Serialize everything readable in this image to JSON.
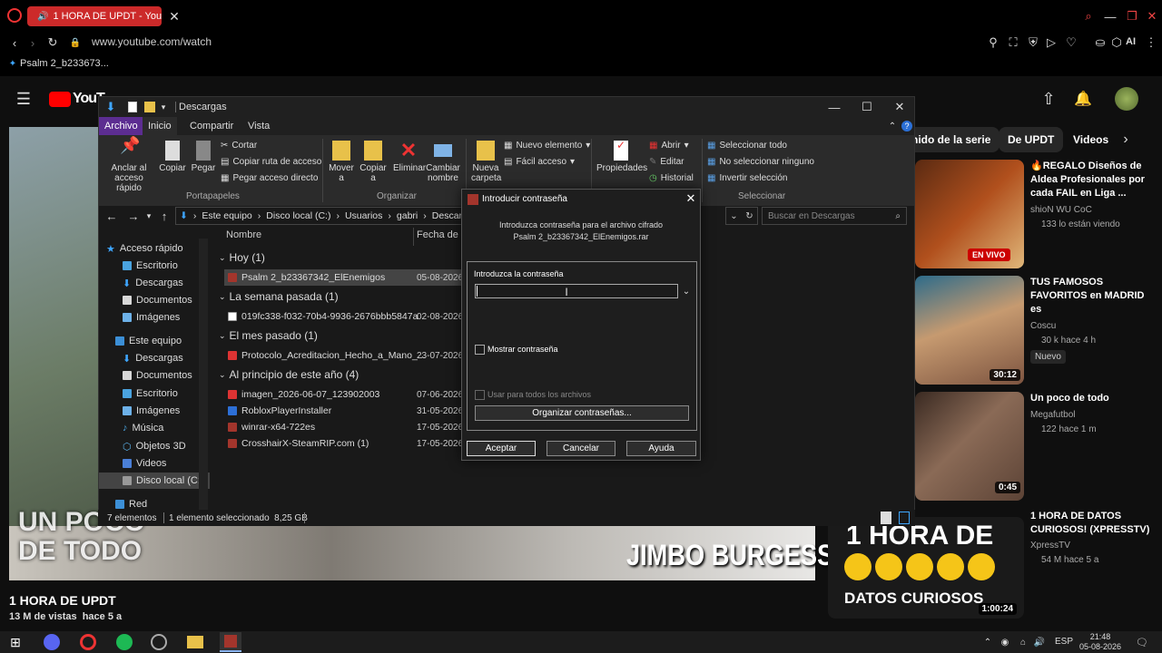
{
  "browser": {
    "tab_title": "1 HORA DE UPDT - You",
    "url": "www.youtube.com/watch",
    "bookmark": "Psalm 2_b233673...",
    "ai_label": "AI"
  },
  "youtube": {
    "logo_text": "YouT",
    "chips": [
      "nido de la serie",
      "De UPDT",
      "Videos"
    ],
    "video_title": "1 HORA DE UPDT",
    "video_meta": "13 M de vistas  hace 5 a",
    "overlay_left": "UN POCO\nDE TODO",
    "overlay_right": "JIMBO BURGESS",
    "related": [
      {
        "title": "🔥REGALO Diseños de Aldea Profesionales por cada FAIL en Liga ...",
        "channel": "shioN WU CoC",
        "meta": "133 lo están viendo",
        "badge": "EN VIVO"
      },
      {
        "title": "TUS FAMOSOS FAVORITOS en MADRID es",
        "channel": "Coscu",
        "meta": "30 k  hace 4 h",
        "badge": "Nuevo",
        "duration": "30:12"
      },
      {
        "title": "Un poco de todo",
        "channel": "Megafutbol",
        "meta": "122  hace 1 m",
        "duration": "0:45"
      },
      {
        "title": "1 HORA DE DATOS CURIOSOS! (XPRESSTV)",
        "channel": "XpressTV",
        "meta": "54 M  hace 5 a",
        "duration": "1:00:24",
        "thumb_top": "1 HORA DE",
        "thumb_bottom": "DATOS CURIOSOS"
      }
    ]
  },
  "explorer": {
    "title": "Descargas",
    "tabs": [
      "Archivo",
      "Inicio",
      "Compartir",
      "Vista"
    ],
    "ribbon": {
      "anclar": "Anclar al acceso rápido",
      "copiar": "Copiar",
      "pegar": "Pegar",
      "cortar": "Cortar",
      "copiar_ruta": "Copiar ruta de acceso",
      "pegar_acceso": "Pegar acceso directo",
      "portapapeles": "Portapapeles",
      "mover": "Mover a",
      "copiar_a": "Copiar a",
      "eliminar": "Eliminar",
      "cambiar": "Cambiar nombre",
      "organizar": "Organizar",
      "nueva": "Nueva carpeta",
      "nuevo_elemento": "Nuevo elemento",
      "facil": "Fácil acceso",
      "propiedades": "Propiedades",
      "abrir": "Abrir",
      "editar": "Editar",
      "historial": "Historial",
      "seleccionar_todo": "Seleccionar todo",
      "no_seleccionar": "No seleccionar ninguno",
      "invertir": "Invertir selección",
      "seleccionar": "Seleccionar"
    },
    "breadcrumb": [
      "Este equipo",
      "Disco local (C:)",
      "Usuarios",
      "gabri",
      "Descarga"
    ],
    "search_placeholder": "Buscar en Descargas",
    "columns": {
      "name": "Nombre",
      "date": "Fecha de m"
    },
    "sidebar": [
      "Acceso rápido",
      "Escritorio",
      "Descargas",
      "Documentos",
      "Imágenes",
      "Este equipo",
      "Descargas",
      "Documentos",
      "Escritorio",
      "Imágenes",
      "Música",
      "Objetos 3D",
      "Videos",
      "Disco local (C:)",
      "Red"
    ],
    "groups": [
      {
        "label": "Hoy (1)",
        "files": [
          {
            "name": "Psalm 2_b23367342_ElEnemigos",
            "date": "05-08-2026"
          }
        ]
      },
      {
        "label": "La semana pasada (1)",
        "files": [
          {
            "name": "019fc338-f032-70b4-9936-2676bbb5847a",
            "date": "02-08-2026"
          }
        ]
      },
      {
        "label": "El mes pasado (1)",
        "files": [
          {
            "name": "Protocolo_Acreditacion_Hecho_a_Mano_...",
            "date": "23-07-2026"
          }
        ]
      },
      {
        "label": "Al principio de este año (4)",
        "files": [
          {
            "name": "imagen_2026-06-07_123902003",
            "date": "07-06-2026"
          },
          {
            "name": "RobloxPlayerInstaller",
            "date": "31-05-2026"
          },
          {
            "name": "winrar-x64-722es",
            "date": "17-05-2026"
          },
          {
            "name": "CrosshairX-SteamRIP.com (1)",
            "date": "17-05-2026"
          }
        ]
      }
    ],
    "status": {
      "count": "7 elementos",
      "selected": "1 elemento seleccionado  8,25 GB"
    }
  },
  "dialog": {
    "title": "Introducir contraseña",
    "message1": "Introduzca contraseña para el archivo cifrado",
    "message2": "Psalm 2_b23367342_ElEnemigos.rar",
    "group_label": "Introduzca la contraseña",
    "password_value": "",
    "show_password": "Mostrar contraseña",
    "use_all": "Usar para todos los archivos",
    "organize": "Organizar contraseñas...",
    "ok": "Aceptar",
    "cancel": "Cancelar",
    "help": "Ayuda"
  },
  "taskbar": {
    "lang": "ESP",
    "time": "21:48",
    "date": "05-08-2026"
  }
}
